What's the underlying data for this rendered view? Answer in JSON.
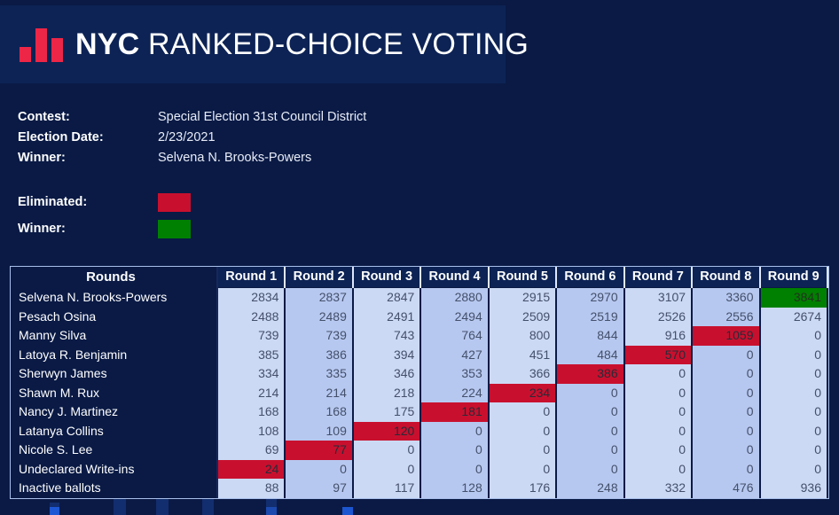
{
  "header": {
    "logo_name": "nyc-bar-chart-logo",
    "brand_bold": "NYC",
    "brand_rest": " RANKED-CHOICE VOTING"
  },
  "meta": {
    "contest_label": "Contest:",
    "contest_value": "Special Election 31st Council District",
    "election_date_label": "Election Date:",
    "election_date_value": "2/23/2021",
    "winner_label": "Winner:",
    "winner_value": "Selvena N. Brooks-Powers",
    "legend_eliminated_label": "Eliminated:",
    "legend_winner_label": "Winner:",
    "eliminated_color": "#c8102e",
    "winner_color": "#008000"
  },
  "table": {
    "corner_header": "Rounds",
    "round_headers": [
      "Round 1",
      "Round 2",
      "Round 3",
      "Round 4",
      "Round 5",
      "Round 6",
      "Round 7",
      "Round 8",
      "Round 9"
    ],
    "rows": [
      {
        "name": "Selvena N. Brooks-Powers",
        "values": [
          "2834",
          "2837",
          "2847",
          "2880",
          "2915",
          "2970",
          "3107",
          "3360",
          "3841"
        ],
        "states": [
          "",
          "",
          "",
          "",
          "",
          "",
          "",
          "",
          "win"
        ]
      },
      {
        "name": "Pesach Osina",
        "values": [
          "2488",
          "2489",
          "2491",
          "2494",
          "2509",
          "2519",
          "2526",
          "2556",
          "2674"
        ],
        "states": [
          "",
          "",
          "",
          "",
          "",
          "",
          "",
          "",
          ""
        ]
      },
      {
        "name": "Manny Silva",
        "values": [
          "739",
          "739",
          "743",
          "764",
          "800",
          "844",
          "916",
          "1059",
          "0"
        ],
        "states": [
          "",
          "",
          "",
          "",
          "",
          "",
          "",
          "elim",
          ""
        ]
      },
      {
        "name": "Latoya R. Benjamin",
        "values": [
          "385",
          "386",
          "394",
          "427",
          "451",
          "484",
          "570",
          "0",
          "0"
        ],
        "states": [
          "",
          "",
          "",
          "",
          "",
          "",
          "elim",
          "",
          ""
        ]
      },
      {
        "name": "Sherwyn James",
        "values": [
          "334",
          "335",
          "346",
          "353",
          "366",
          "386",
          "0",
          "0",
          "0"
        ],
        "states": [
          "",
          "",
          "",
          "",
          "",
          "elim",
          "",
          "",
          ""
        ]
      },
      {
        "name": "Shawn M. Rux",
        "values": [
          "214",
          "214",
          "218",
          "224",
          "234",
          "0",
          "0",
          "0",
          "0"
        ],
        "states": [
          "",
          "",
          "",
          "",
          "elim",
          "",
          "",
          "",
          ""
        ]
      },
      {
        "name": "Nancy J. Martinez",
        "values": [
          "168",
          "168",
          "175",
          "181",
          "0",
          "0",
          "0",
          "0",
          "0"
        ],
        "states": [
          "",
          "",
          "",
          "elim",
          "",
          "",
          "",
          "",
          ""
        ]
      },
      {
        "name": "Latanya Collins",
        "values": [
          "108",
          "109",
          "120",
          "0",
          "0",
          "0",
          "0",
          "0",
          "0"
        ],
        "states": [
          "",
          "",
          "elim",
          "",
          "",
          "",
          "",
          "",
          ""
        ]
      },
      {
        "name": "Nicole S. Lee",
        "values": [
          "69",
          "77",
          "0",
          "0",
          "0",
          "0",
          "0",
          "0",
          "0"
        ],
        "states": [
          "",
          "elim",
          "",
          "",
          "",
          "",
          "",
          "",
          ""
        ]
      },
      {
        "name": "Undeclared Write-ins",
        "values": [
          "24",
          "0",
          "0",
          "0",
          "0",
          "0",
          "0",
          "0",
          "0"
        ],
        "states": [
          "elim",
          "",
          "",
          "",
          "",
          "",
          "",
          "",
          ""
        ]
      },
      {
        "name": "Inactive ballots",
        "values": [
          "88",
          "97",
          "117",
          "128",
          "176",
          "248",
          "332",
          "476",
          "936"
        ],
        "states": [
          "",
          "",
          "",
          "",
          "",
          "",
          "",
          "",
          ""
        ]
      }
    ]
  }
}
